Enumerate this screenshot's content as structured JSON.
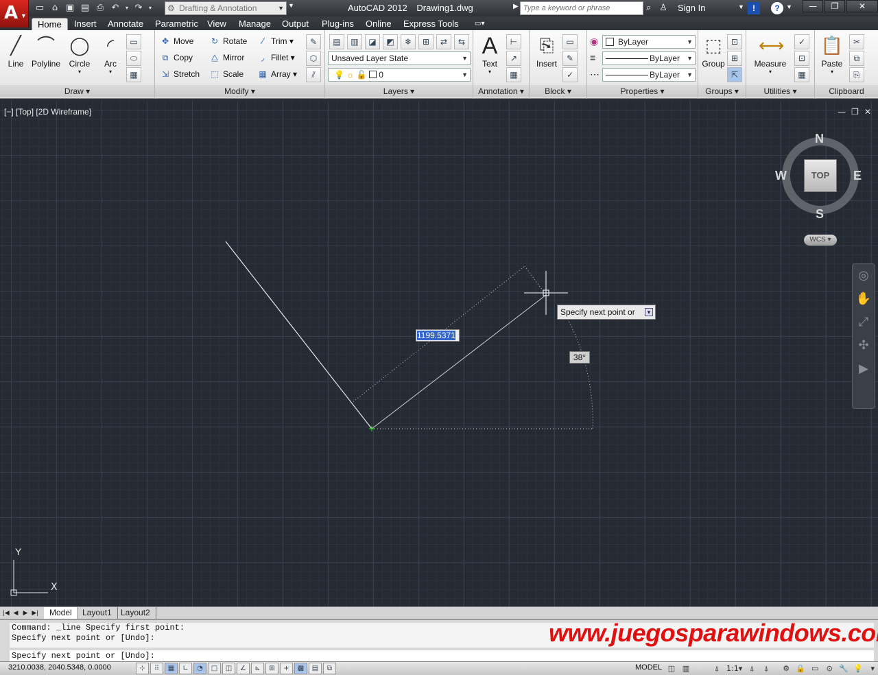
{
  "app": {
    "logo_glyph": "A",
    "workspace": "Drafting & Annotation",
    "title": "AutoCAD 2012",
    "document": "Drawing1.dwg",
    "search_placeholder": "Type a keyword or phrase",
    "sign_in": "Sign In"
  },
  "tabs": [
    "Home",
    "Insert",
    "Annotate",
    "Parametric",
    "View",
    "Manage",
    "Output",
    "Plug-ins",
    "Online",
    "Express Tools"
  ],
  "ribbon": {
    "draw": {
      "title": "Draw",
      "line": "Line",
      "polyline": "Polyline",
      "circle": "Circle",
      "arc": "Arc"
    },
    "modify": {
      "title": "Modify",
      "move": "Move",
      "rotate": "Rotate",
      "trim": "Trim",
      "copy": "Copy",
      "mirror": "Mirror",
      "fillet": "Fillet",
      "stretch": "Stretch",
      "scale": "Scale",
      "array": "Array"
    },
    "layers": {
      "title": "Layers",
      "layer_state": "Unsaved Layer State",
      "current_layer": "0"
    },
    "annotation": {
      "title": "Annotation",
      "text": "Text"
    },
    "block": {
      "title": "Block",
      "insert": "Insert"
    },
    "properties": {
      "title": "Properties",
      "color": "ByLayer",
      "linetype": "ByLayer",
      "lineweight": "ByLayer"
    },
    "groups": {
      "title": "Groups",
      "group": "Group"
    },
    "utilities": {
      "title": "Utilities",
      "measure": "Measure"
    },
    "clipboard": {
      "title": "Clipboard",
      "paste": "Paste"
    }
  },
  "viewport": {
    "label": "[−] [Top] [2D Wireframe]",
    "length_input": "1199.5371",
    "angle_label": "38°",
    "prompt": "Specify next point or"
  },
  "viewcube": {
    "face": "TOP",
    "north": "N",
    "south": "S",
    "east": "E",
    "west": "W",
    "wcs": "WCS"
  },
  "ucs": {
    "y": "Y",
    "x": "X"
  },
  "layout_tabs": [
    "Model",
    "Layout1",
    "Layout2"
  ],
  "command": {
    "history": [
      "Command: _line Specify first point:",
      "Specify next point or [Undo]:"
    ],
    "current": "Specify next point or [Undo]:"
  },
  "watermark": "www.juegosparawindows.com",
  "status": {
    "coords": "3210.0038, 2040.5348, 0.0000",
    "model": "MODEL",
    "scale": "1:1"
  },
  "colors": {
    "viewport_bg": "#252a33",
    "accent_red": "#e01010",
    "line": "#e8e8e8"
  }
}
